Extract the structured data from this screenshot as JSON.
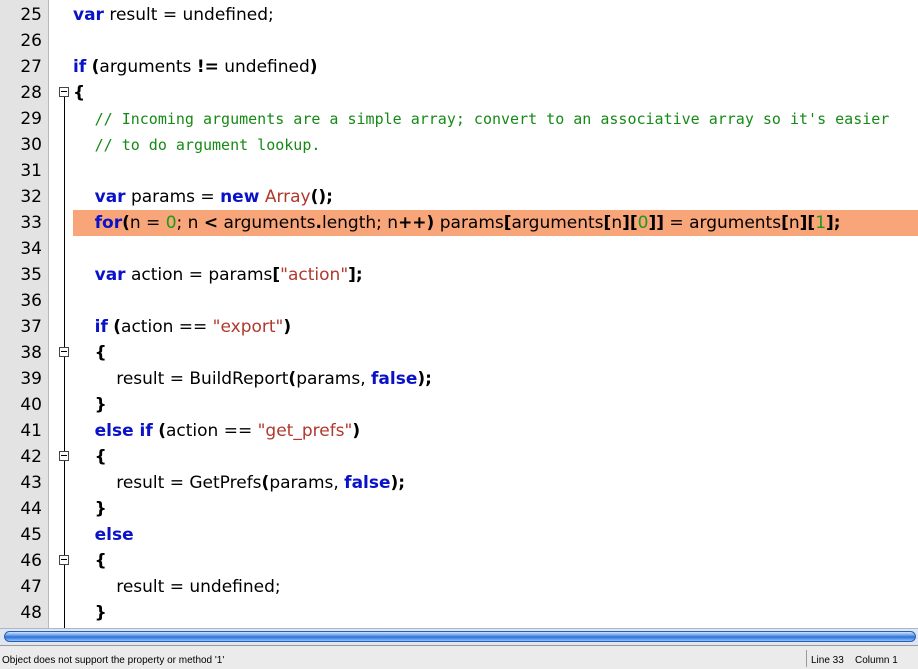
{
  "editor": {
    "lines": [
      {
        "n": "25",
        "code": "var result = undefined;"
      },
      {
        "n": "26",
        "code": ""
      },
      {
        "n": "27",
        "code": "if (arguments != undefined)"
      },
      {
        "n": "28",
        "code": "{"
      },
      {
        "n": "29",
        "code": "    // Incoming arguments are a simple array; convert to an associative array so it's easier"
      },
      {
        "n": "30",
        "code": "    // to do argument lookup."
      },
      {
        "n": "31",
        "code": ""
      },
      {
        "n": "32",
        "code": "    var params = new Array();"
      },
      {
        "n": "33",
        "code": "    for(n = 0; n < arguments.length; n++) params[arguments[n][0]] = arguments[n][1];"
      },
      {
        "n": "34",
        "code": ""
      },
      {
        "n": "35",
        "code": "    var action = params[\"action\"];"
      },
      {
        "n": "36",
        "code": ""
      },
      {
        "n": "37",
        "code": "    if (action == \"export\")"
      },
      {
        "n": "38",
        "code": "    {"
      },
      {
        "n": "39",
        "code": "        result = BuildReport(params, false);"
      },
      {
        "n": "40",
        "code": "    }"
      },
      {
        "n": "41",
        "code": "    else if (action == \"get_prefs\")"
      },
      {
        "n": "42",
        "code": "    {"
      },
      {
        "n": "43",
        "code": "        result = GetPrefs(params, false);"
      },
      {
        "n": "44",
        "code": "    }"
      },
      {
        "n": "45",
        "code": "    else"
      },
      {
        "n": "46",
        "code": "    {"
      },
      {
        "n": "47",
        "code": "        result = undefined;"
      },
      {
        "n": "48",
        "code": "    }"
      }
    ],
    "highlighted_line": "33",
    "highlight_color": "#f8a57a"
  },
  "status": {
    "message": "Object does not support the property or method '1'",
    "line": "Line 33",
    "column": "Column 1"
  }
}
